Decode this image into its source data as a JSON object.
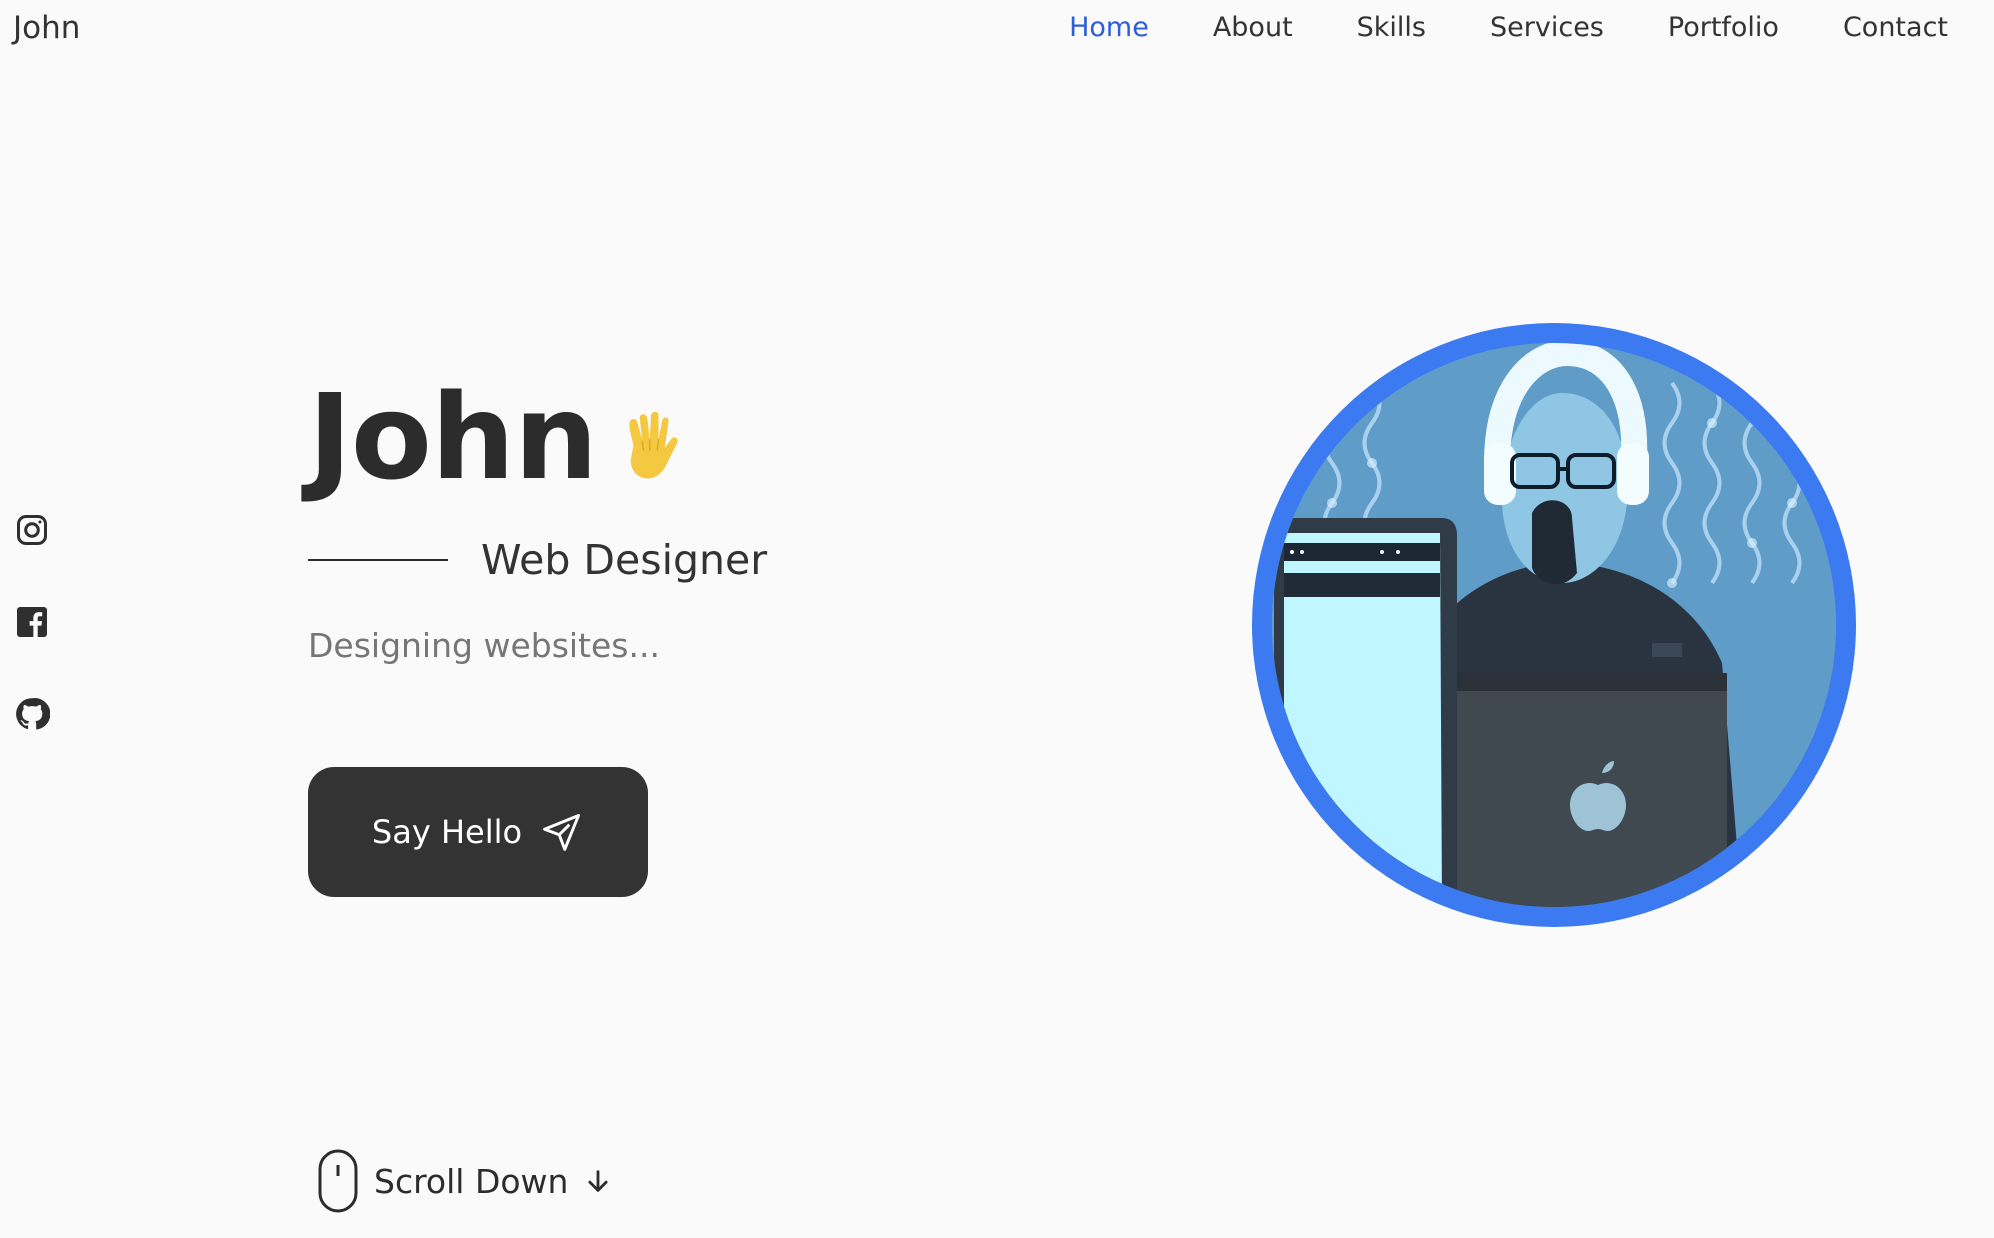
{
  "brand": {
    "logo_text": "John"
  },
  "nav": {
    "items": [
      {
        "label": "Home",
        "active": true
      },
      {
        "label": "About",
        "active": false
      },
      {
        "label": "Skills",
        "active": false
      },
      {
        "label": "Services",
        "active": false
      },
      {
        "label": "Portfolio",
        "active": false
      },
      {
        "label": "Contact",
        "active": false
      }
    ]
  },
  "social": {
    "icons": [
      "instagram-icon",
      "facebook-icon",
      "github-icon"
    ]
  },
  "hero": {
    "name": "John",
    "wave_icon": "waving-hand-icon",
    "role": "Web Designer",
    "description": "Designing websites...",
    "cta_label": "Say Hello",
    "cta_icon": "paper-plane-icon",
    "scroll_label": "Scroll Down",
    "scroll_icons": [
      "mouse-icon",
      "arrow-down-icon"
    ]
  },
  "colors": {
    "background": "#fafafa",
    "text": "#2c2c2c",
    "accent_nav": "#2c5ed8",
    "portrait_ring": "#3b7af0",
    "button_bg": "#333333",
    "muted_text": "#767676"
  }
}
